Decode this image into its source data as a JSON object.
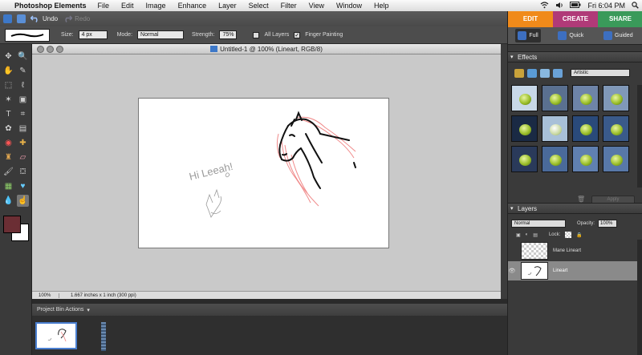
{
  "menubar": {
    "app_name": "Photoshop Elements",
    "menus": [
      "File",
      "Edit",
      "Image",
      "Enhance",
      "Layer",
      "Select",
      "Filter",
      "View",
      "Window",
      "Help"
    ],
    "clock": "Fri 6:04 PM"
  },
  "optbar": {
    "undo": "Undo",
    "redo": "Redo"
  },
  "tool_options": {
    "size_label": "Size:",
    "size_value": "4 px",
    "mode_label": "Mode:",
    "mode_value": "Normal",
    "strength_label": "Strength:",
    "strength_value": "75%",
    "all_layers": "All Layers",
    "finger_painting": "Finger Painting"
  },
  "document": {
    "title": "Untitled-1 @ 100% (Lineart, RGB/8)",
    "zoom": "100%",
    "info": "1.667 inches x 1 inch (300 ppi)",
    "sketch_text": "Hi Leeah!"
  },
  "bin": {
    "label": "Project Bin Actions"
  },
  "right_panel": {
    "tabs": [
      "EDIT",
      "CREATE",
      "SHARE"
    ],
    "subtabs": [
      "Full",
      "Quick",
      "Guided"
    ],
    "effects_title": "Effects",
    "effects_category": "Artistic",
    "apply_label": "Apply",
    "layers_title": "Layers",
    "blend_mode": "Normal",
    "opacity_label": "Opacity:",
    "opacity_value": "100%",
    "lock_label": "Lock:",
    "layers": [
      {
        "name": "Mane Lineart",
        "visible": false,
        "selected": false
      },
      {
        "name": "Lineart",
        "visible": true,
        "selected": true
      }
    ]
  },
  "colors": {
    "foreground": "#6b2e34",
    "background": "#ffffff",
    "edit_tab": "#f08a1a",
    "create_tab": "#b03a78",
    "share_tab": "#3a9a5a"
  }
}
